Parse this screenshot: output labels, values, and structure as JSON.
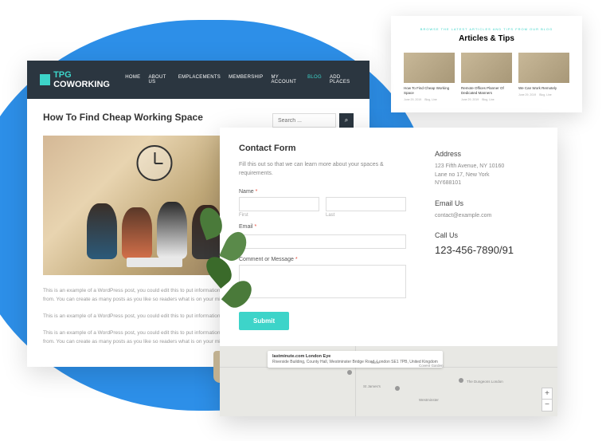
{
  "blog": {
    "logo_prefix": "TPG",
    "logo_suffix": "COWORKING",
    "nav": [
      "HOME",
      "ABOUT US",
      "EMPLACEMENTS",
      "MEMBERSHIP",
      "MY ACCOUNT",
      "BLOG",
      "ADD PLACES"
    ],
    "title": "How To Find Cheap Working Space",
    "search_placeholder": "Search ...",
    "para1": "This is an example of a WordPress post, you could edit this to put information about yourself so readers know where you are coming from. You can create as many posts as you like so readers what is on your mind.",
    "para2": "This is an example of a WordPress post, you could edit this to put information about yourself.",
    "para3": "This is an example of a WordPress post, you could edit this to put information about yourself so readers know where you are coming from. You can create as many posts as you like so readers what is on your mind."
  },
  "contact": {
    "title": "Contact Form",
    "subtitle": "Fill this out so that we can learn more about your spaces & requirements.",
    "name_label": "Name",
    "first_label": "First",
    "last_label": "Last",
    "email_label": "Email",
    "comment_label": "Comment or Message",
    "submit": "Submit",
    "address_title": "Address",
    "address_text": "123 Fifth Avenue, NY 10160\nLane no 17, New York\nNY688101",
    "email_title": "Email Us",
    "email_text": "contact@example.com",
    "call_title": "Call Us",
    "phone": "123-456-7890/91",
    "map_tooltip_title": "lastminute.com London Eye",
    "map_tooltip_text": "Riverside Building, County Hall, Westminster Bridge Road, London SE1 7PB, United Kingdom",
    "map_labels": [
      "Soho",
      "St James's",
      "Covent Garden",
      "The Dungeons London",
      "Westminster"
    ]
  },
  "articles": {
    "eyebrow": "BROWSE THE LATEST ARTICLES AND TIPS FROM OUR BLOG",
    "title": "Articles & Tips",
    "items": [
      {
        "title": "How To Find Cheap Working Space",
        "date": "June 29, 2019",
        "cat": "Blog, Line"
      },
      {
        "title": "Remote Offices Planner Of Dedicated Manners",
        "date": "June 29, 2019",
        "cat": "Blog, Line"
      },
      {
        "title": "We Can Work Remotely",
        "date": "June 29, 2019",
        "cat": "Blog, Line"
      }
    ]
  }
}
